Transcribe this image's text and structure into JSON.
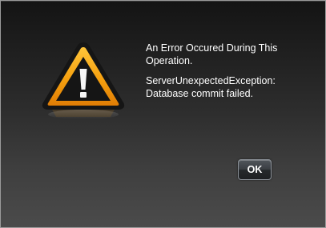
{
  "dialog": {
    "icon": "warning-triangle-icon",
    "message": {
      "heading": "An Error Occured During This Operation.",
      "detail": "ServerUnexpectedException: Database commit failed."
    },
    "ok_label": "OK"
  },
  "colors": {
    "warning_fill": "#f5a00f",
    "warning_border": "#1a1a1a",
    "button_border": "#8a9097",
    "text": "#ffffff"
  }
}
